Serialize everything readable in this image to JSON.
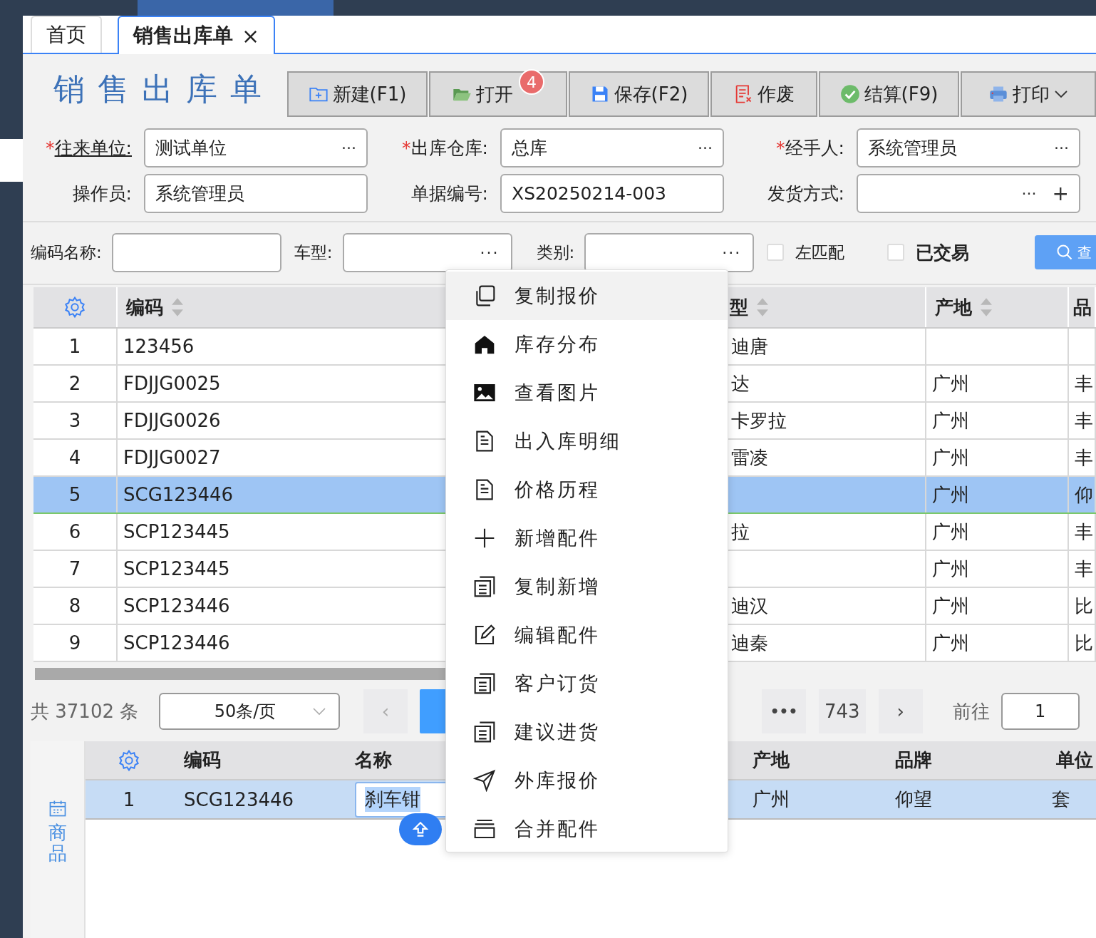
{
  "tabs": [
    {
      "label": "首页",
      "selected": false
    },
    {
      "label": "销售出库单",
      "selected": true,
      "close": "×"
    }
  ],
  "title": "销售出库单",
  "toolbar": [
    {
      "kind": "new",
      "label": "新建(F1)"
    },
    {
      "kind": "open",
      "label": "打开",
      "badge": "4"
    },
    {
      "kind": "save",
      "label": "保存(F2)"
    },
    {
      "kind": "void",
      "label": "作废"
    },
    {
      "kind": "settle",
      "label": "结算(F9)"
    },
    {
      "kind": "print",
      "label": "打印",
      "dropdown": true
    }
  ],
  "form": [
    {
      "label": "往来单位:",
      "required": "*",
      "underlined": true,
      "value": "测试单位",
      "ellipsis": "···"
    },
    {
      "label": "出库仓库:",
      "required": "*",
      "value": "总库",
      "ellipsis": "···"
    },
    {
      "label": "经手人:",
      "required": "*",
      "value": "系统管理员",
      "ellipsis": "···"
    },
    {
      "label": "操作员:",
      "value": "系统管理员"
    },
    {
      "label": "单据编号:",
      "value": "XS20250214-003"
    },
    {
      "label": "发货方式:",
      "ellipsis": "···",
      "plus": "+"
    }
  ],
  "filters": {
    "fields": [
      {
        "label": "编码名称:"
      },
      {
        "label": "车型:",
        "ellipsis": "···"
      },
      {
        "label": "类别:",
        "ellipsis": "···"
      }
    ],
    "checkboxes": [
      {
        "label": "左匹配",
        "checked": false,
        "bold": false
      },
      {
        "label": "已交易",
        "checked": false,
        "bold": true
      }
    ],
    "search_button": "查"
  },
  "table": {
    "columns": [
      {
        "label": "编码",
        "sortable": true
      },
      {
        "label": "型",
        "sortable": true
      },
      {
        "label": "产地",
        "sortable": true
      },
      {
        "label": "品",
        "sortable": false
      }
    ],
    "rows": [
      {
        "index": "1",
        "code": "123456",
        "model": "迪唐",
        "selected": false
      },
      {
        "index": "2",
        "code": "FDJJG0025",
        "model": "达",
        "origin": "广州",
        "brand": "丰",
        "selected": false
      },
      {
        "index": "3",
        "code": "FDJJG0026",
        "model": "卡罗拉",
        "origin": "广州",
        "brand": "丰",
        "selected": false
      },
      {
        "index": "4",
        "code": "FDJJG0027",
        "model": "雷凌",
        "origin": "广州",
        "brand": "丰",
        "selected": false
      },
      {
        "index": "5",
        "code": "SCG123446",
        "origin": "广州",
        "brand": "仰",
        "selected": true
      },
      {
        "index": "6",
        "code": "SCP123445",
        "model": "拉",
        "origin": "广州",
        "brand": "丰",
        "selected": false
      },
      {
        "index": "7",
        "code": "SCP123445",
        "origin": "广州",
        "brand": "丰",
        "selected": false
      },
      {
        "index": "8",
        "code": "SCP123446",
        "model": "迪汉",
        "origin": "广州",
        "brand": "比",
        "selected": false
      },
      {
        "index": "9",
        "code": "SCP123446",
        "model": "迪秦",
        "origin": "广州",
        "brand": "比",
        "selected": false
      }
    ]
  },
  "pagination": {
    "total": "共 37102 条",
    "page_size": "50条/页",
    "prev": "‹",
    "ellipsis": "•••",
    "last_page": "743",
    "next": "›",
    "goto_label": "前往",
    "goto_value": "1"
  },
  "context_menu": [
    {
      "kind": "copy",
      "label": "复制报价",
      "selected": true
    },
    {
      "kind": "home",
      "label": "库存分布",
      "selected": false
    },
    {
      "kind": "image",
      "label": "查看图片",
      "selected": false
    },
    {
      "kind": "doc",
      "label": "出入库明细",
      "selected": false
    },
    {
      "kind": "doc",
      "label": "价格历程",
      "selected": false
    },
    {
      "kind": "plus",
      "label": "新增配件",
      "selected": false
    },
    {
      "kind": "list",
      "label": "复制新增",
      "selected": false
    },
    {
      "kind": "edit",
      "label": "编辑配件",
      "selected": false
    },
    {
      "kind": "list",
      "label": "客户订货",
      "selected": false
    },
    {
      "kind": "list",
      "label": "建议进货",
      "selected": false
    },
    {
      "kind": "send",
      "label": "外库报价",
      "selected": false
    },
    {
      "kind": "tray",
      "label": "合并配件",
      "selected": false
    }
  ],
  "detail": {
    "side_tab": "商品",
    "columns": [
      "编码",
      "名称",
      "产地",
      "品牌",
      "单位"
    ],
    "rows": [
      {
        "index": "1",
        "code": "SCG123446",
        "name": "刹车钳",
        "origin": "广州",
        "brand": "仰望",
        "unit": "套",
        "selected": true
      }
    ]
  }
}
